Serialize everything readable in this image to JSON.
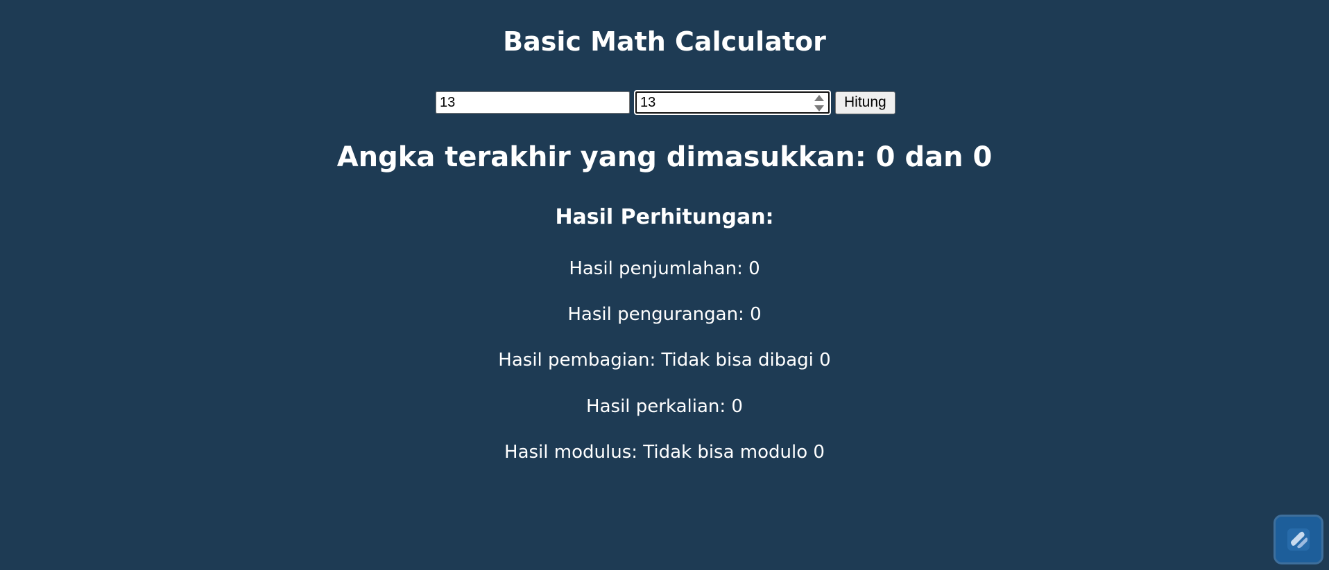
{
  "page": {
    "title": "Basic Math Calculator"
  },
  "form": {
    "input_a_value": "13",
    "input_b_value": "13",
    "button_label": "Hitung"
  },
  "last_entered": "Angka terakhir yang dimasukkan: 0 dan 0",
  "results": {
    "heading": "Hasil Perhitungan:",
    "addition": "Hasil penjumlahan: 0",
    "subtraction": "Hasil pengurangan: 0",
    "division": "Hasil pembagian: Tidak bisa dibagi 0",
    "multiplication": "Hasil perkalian: 0",
    "modulus": "Hasil modulus: Tidak bisa modulo 0"
  },
  "colors": {
    "background": "#1e3b54",
    "text": "#ffffff",
    "widget": "#1d5e9a"
  },
  "icons": {
    "corner_widget": "slash-logo-icon"
  }
}
